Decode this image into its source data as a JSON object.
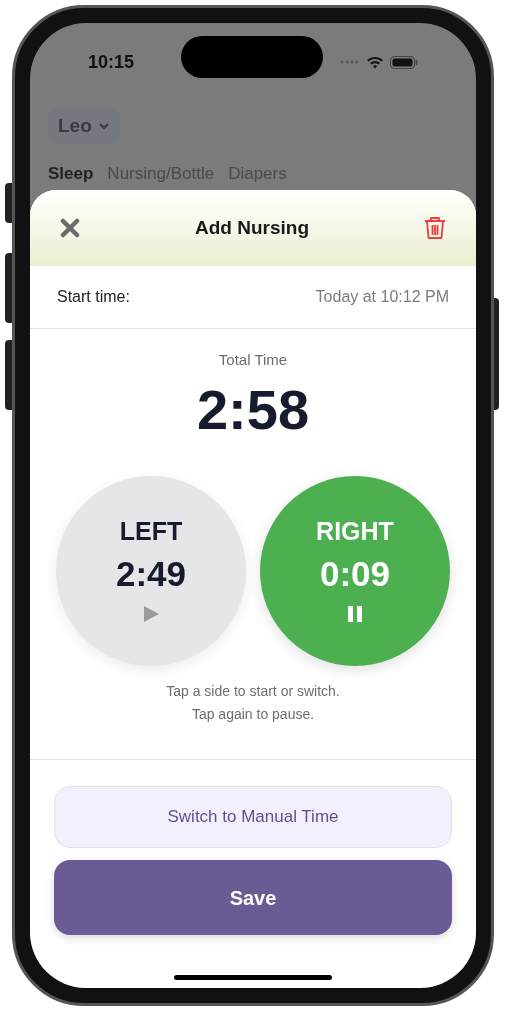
{
  "status_bar": {
    "time": "10:15"
  },
  "background": {
    "child_selector": "Leo",
    "tabs": [
      {
        "label": "Sleep",
        "selected": true
      },
      {
        "label": "Nursing/Bottle",
        "selected": false
      },
      {
        "label": "Diapers",
        "selected": false
      }
    ]
  },
  "sheet": {
    "title": "Add Nursing",
    "start_time": {
      "label": "Start time:",
      "value": "Today at 10:12 PM"
    },
    "total": {
      "label": "Total Time",
      "value": "2:58"
    },
    "sides": [
      {
        "label": "LEFT",
        "time": "2:49",
        "running": false
      },
      {
        "label": "RIGHT",
        "time": "0:09",
        "running": true
      }
    ],
    "hint": [
      "Tap a side to start or switch.",
      "Tap again to pause."
    ],
    "buttons": [
      {
        "kind": "secondary",
        "label": "Switch to Manual Time"
      },
      {
        "kind": "primary",
        "label": "Save"
      }
    ]
  }
}
